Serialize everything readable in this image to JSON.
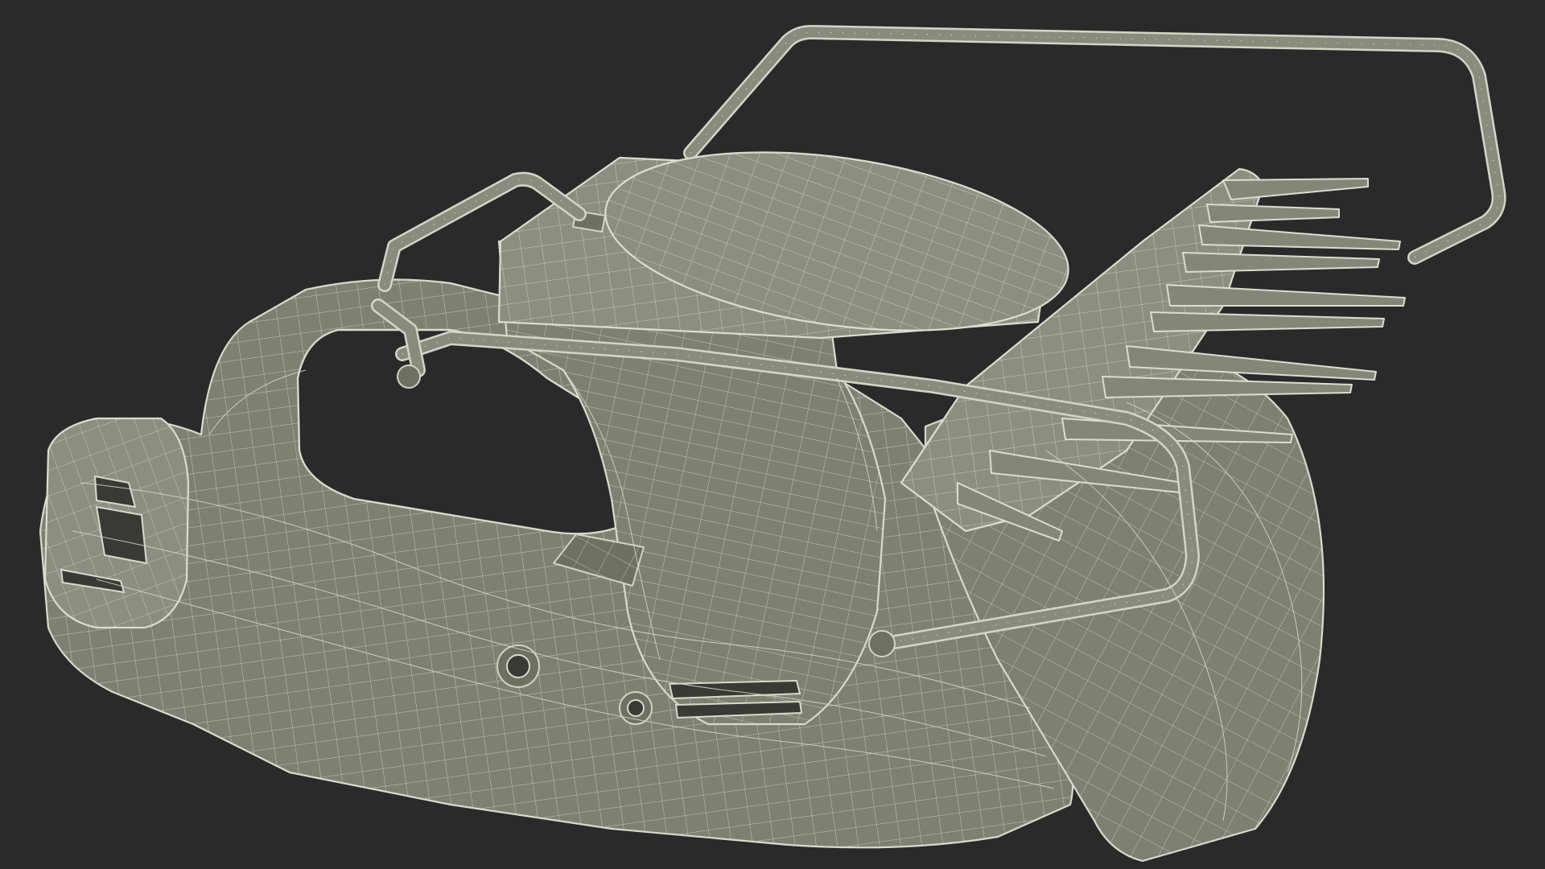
{
  "scene": {
    "subject": "hedge trimmer",
    "render_style": "wireframe",
    "colors": {
      "background": "#2a2a2a",
      "surface": "#7f7f73",
      "wire": "#d9d9cd"
    }
  }
}
